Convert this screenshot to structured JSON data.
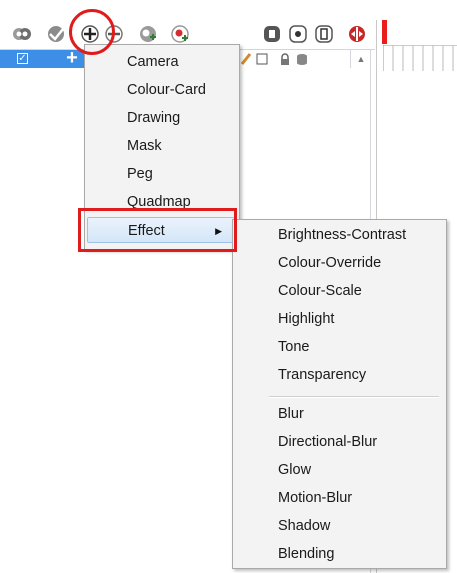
{
  "menu": {
    "items": [
      {
        "label": "Camera"
      },
      {
        "label": "Colour-Card"
      },
      {
        "label": "Drawing"
      },
      {
        "label": "Mask"
      },
      {
        "label": "Peg"
      },
      {
        "label": "Quadmap"
      },
      {
        "label": "Effect",
        "highlighted": true,
        "has_submenu": true
      }
    ],
    "submenu_arrow": "▶"
  },
  "submenu": {
    "group1": [
      "Brightness-Contrast",
      "Colour-Override",
      "Colour-Scale",
      "Highlight",
      "Tone",
      "Transparency"
    ],
    "group2": [
      "Blur",
      "Directional-Blur",
      "Glow",
      "Motion-Blur",
      "Shadow",
      "Blending"
    ]
  },
  "toolbar": {
    "buttons": [
      "onion-skin-icon",
      "show-hide-icon",
      "add-layer-icon",
      "remove-layer-icon",
      "add-peg-icon",
      "add-drawing-icon",
      "lock-column-icon",
      "record-icon",
      "display-icon",
      "split-icon"
    ]
  },
  "track_header": {
    "checkbox_mark": "✓",
    "add_symbol": "+",
    "scroll_up_glyph": "▲"
  },
  "colors": {
    "annotation_red": "#e01b1b",
    "selection_blue": "#3d8ee6",
    "playhead_red": "#ea1c1c"
  }
}
